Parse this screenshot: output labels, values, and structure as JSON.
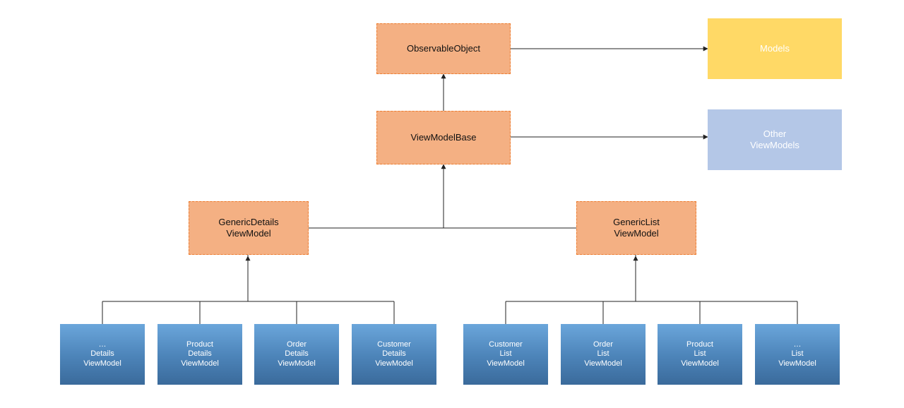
{
  "nodes": {
    "observable": {
      "label": "ObservableObject"
    },
    "vmbase": {
      "label": "ViewModelBase"
    },
    "models": {
      "label": "Models"
    },
    "otherVM": {
      "line1": "Other",
      "line2": "ViewModels"
    },
    "genDetails": {
      "line1": "GenericDetails",
      "line2": "ViewModel"
    },
    "genList": {
      "line1": "GenericList",
      "line2": "ViewModel"
    },
    "detailsLeaves": [
      {
        "l1": "…",
        "l2": "Details",
        "l3": "ViewModel"
      },
      {
        "l1": "Product",
        "l2": "Details",
        "l3": "ViewModel"
      },
      {
        "l1": "Order",
        "l2": "Details",
        "l3": "ViewModel"
      },
      {
        "l1": "Customer",
        "l2": "Details",
        "l3": "ViewModel"
      }
    ],
    "listLeaves": [
      {
        "l1": "Customer",
        "l2": "List",
        "l3": "ViewModel"
      },
      {
        "l1": "Order",
        "l2": "List",
        "l3": "ViewModel"
      },
      {
        "l1": "Product",
        "l2": "List",
        "l3": "ViewModel"
      },
      {
        "l1": "…",
        "l2": "List",
        "l3": "ViewModel"
      }
    ]
  },
  "colors": {
    "orangeFill": "#f4b083",
    "orangeBorder": "#ed7d31",
    "yellow": "#ffd966",
    "lavender": "#b4c7e7",
    "blueTop": "#6ba6db",
    "blueBottom": "#3a6a9b",
    "line": "#222222"
  },
  "chart_data": {
    "type": "hierarchy-diagram",
    "description": "Class/viewmodel inheritance hierarchy",
    "edges": [
      {
        "from": "ViewModelBase",
        "to": "ObservableObject",
        "kind": "inherits"
      },
      {
        "from": "GenericDetails ViewModel",
        "to": "ViewModelBase",
        "kind": "inherits"
      },
      {
        "from": "GenericList ViewModel",
        "to": "ViewModelBase",
        "kind": "inherits"
      },
      {
        "from": "… Details ViewModel",
        "to": "GenericDetails ViewModel",
        "kind": "inherits"
      },
      {
        "from": "Product Details ViewModel",
        "to": "GenericDetails ViewModel",
        "kind": "inherits"
      },
      {
        "from": "Order Details ViewModel",
        "to": "GenericDetails ViewModel",
        "kind": "inherits"
      },
      {
        "from": "Customer Details ViewModel",
        "to": "GenericDetails ViewModel",
        "kind": "inherits"
      },
      {
        "from": "Customer List ViewModel",
        "to": "GenericList ViewModel",
        "kind": "inherits"
      },
      {
        "from": "Order List ViewModel",
        "to": "GenericList ViewModel",
        "kind": "inherits"
      },
      {
        "from": "Product List ViewModel",
        "to": "GenericList ViewModel",
        "kind": "inherits"
      },
      {
        "from": "… List ViewModel",
        "to": "GenericList ViewModel",
        "kind": "inherits"
      },
      {
        "from": "ObservableObject",
        "to": "Models",
        "kind": "association"
      },
      {
        "from": "ViewModelBase",
        "to": "Other ViewModels",
        "kind": "association"
      }
    ]
  }
}
